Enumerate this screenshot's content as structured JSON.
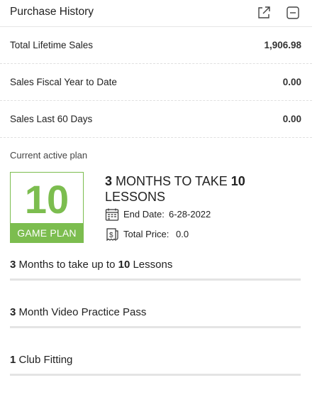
{
  "header": {
    "title": "Purchase History"
  },
  "stats": [
    {
      "label": "Total Lifetime Sales",
      "value": "1,906.98"
    },
    {
      "label": "Sales Fiscal Year to Date",
      "value": "0.00"
    },
    {
      "label": "Sales Last 60 Days",
      "value": "0.00"
    }
  ],
  "plan": {
    "section_label": "Current active plan",
    "badge_number": "10",
    "badge_text": "GAME PLAN",
    "title_num1": "3",
    "title_mid": " MONTHS TO TAKE ",
    "title_num2": "10",
    "title_end": "LESSONS",
    "end_date_label": "End Date:",
    "end_date_value": "6-28-2022",
    "total_price_label": "Total Price:",
    "total_price_value": "0.0"
  },
  "items": [
    {
      "count": "3",
      "text_a": " Months to take up to ",
      "count2": "10",
      "text_b": " Lessons"
    },
    {
      "count": "3",
      "text_a": " Month Video Practice Pass"
    },
    {
      "count": "1",
      "text_a": " Club Fitting"
    }
  ],
  "colors": {
    "accent": "#7cbd4f",
    "divider": "#e4e4e4"
  },
  "icons": [
    "external-link-icon",
    "collapse-icon",
    "calendar-icon",
    "receipt-icon"
  ]
}
